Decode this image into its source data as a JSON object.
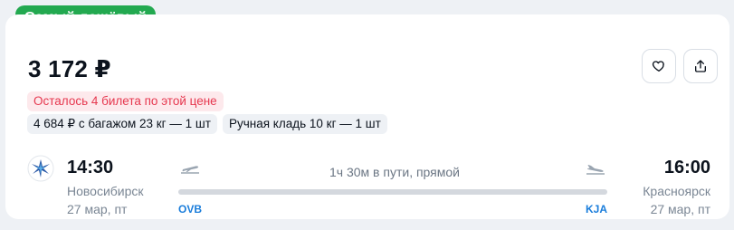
{
  "badge": "Самый дешёвый",
  "price": "3 172 ₽",
  "seats_left": "Осталось 4 билета по этой цене",
  "options": [
    "4 684 ₽ с багажом 23 кг — 1 шт",
    "Ручная кладь 10 кг — 1 шт"
  ],
  "actions": {
    "favorite_icon": "heart-icon",
    "share_icon": "share-icon"
  },
  "airline_logo": "airline-logo",
  "departure": {
    "time": "14:30",
    "city": "Новосибирск",
    "date": "27 мар, пт",
    "iata": "OVB"
  },
  "arrival": {
    "time": "16:00",
    "city": "Красноярск",
    "date": "27 мар, пт",
    "iata": "KJA"
  },
  "duration": "1ч 30м в пути, прямой",
  "colors": {
    "badge": "#23a950",
    "warning_text": "#e6384f",
    "warning_bg": "#fde9ec",
    "iata": "#1a7ddb"
  }
}
